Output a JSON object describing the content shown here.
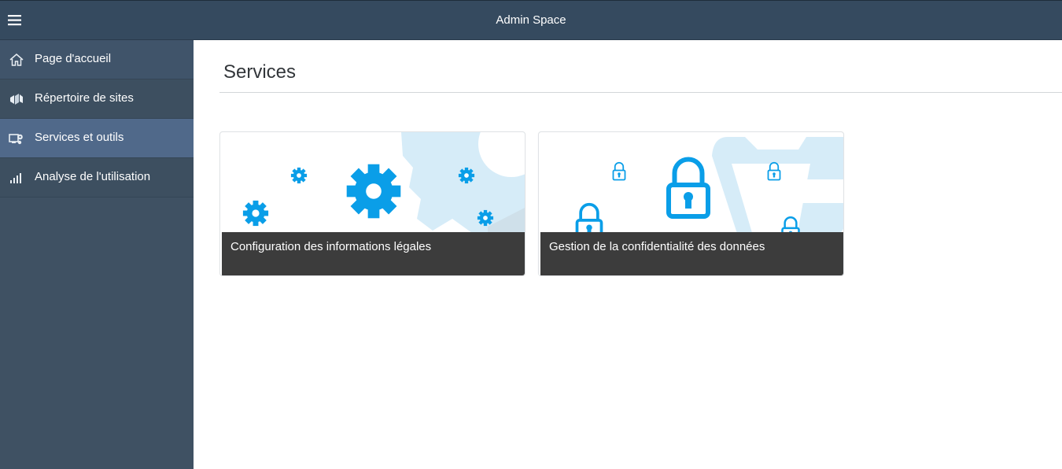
{
  "header": {
    "title": "Admin Space",
    "menu_icon": "hamburger-menu-icon"
  },
  "sidebar": {
    "items": [
      {
        "label": "Page d'accueil",
        "icon": "home-icon",
        "selected": false
      },
      {
        "label": "Répertoire de sites",
        "icon": "site-directory-icon",
        "selected": false
      },
      {
        "label": "Services et outils",
        "icon": "services-tools-icon",
        "selected": true
      },
      {
        "label": "Analyse de l'utilisation",
        "icon": "usage-analytics-icon",
        "selected": false
      }
    ]
  },
  "main": {
    "title": "Services",
    "tiles": [
      {
        "title": "Configuration des informations légales",
        "icon": "gears-icon"
      },
      {
        "title": "Gestion de la confidentialité des données",
        "icon": "padlocks-icon"
      }
    ]
  },
  "colors": {
    "header_bg": "#354a5f",
    "sidebar_bg": "#3f5163",
    "sidebar_selected": "#50698a",
    "accent_blue": "#0a9ee8",
    "light_blue": "#d6ecf8",
    "tile_bar": "#3c3c3c"
  }
}
